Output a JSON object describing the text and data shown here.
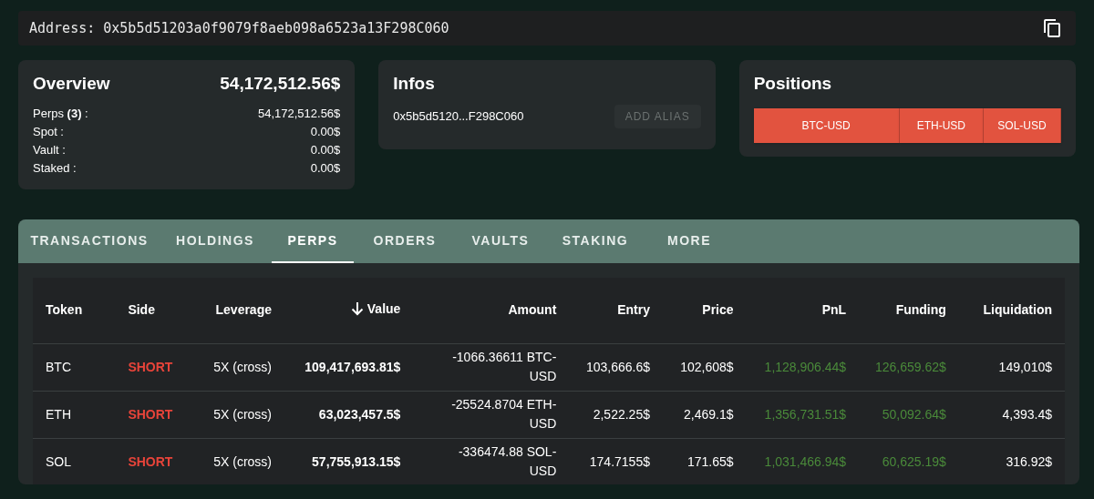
{
  "address_bar": {
    "label": "Address:",
    "address": "0x5b5d51203a0f9079f8aeb098a6523a13F298C060"
  },
  "overview": {
    "title": "Overview",
    "total": "54,172,512.56$",
    "rows": [
      {
        "label": "Perps **(3)** :",
        "value": "54,172,512.56$"
      },
      {
        "label": "Spot :",
        "value": "0.00$"
      },
      {
        "label": "Vault :",
        "value": "0.00$"
      },
      {
        "label": "Staked :",
        "value": "0.00$"
      }
    ]
  },
  "infos": {
    "title": "Infos",
    "address": "0x5b5d5120...F298C060",
    "button": "ADD ALIAS",
    "button_disabled": true
  },
  "positions": {
    "title": "Positions",
    "items": [
      "BTC-USD",
      "ETH-USD",
      "SOL-USD"
    ]
  },
  "tabs": [
    {
      "label": "TRANSACTIONS",
      "selected": false
    },
    {
      "label": "HOLDINGS",
      "selected": false
    },
    {
      "label": "PERPS",
      "selected": true
    },
    {
      "label": "ORDERS",
      "selected": false
    },
    {
      "label": "VAULTS",
      "selected": false
    },
    {
      "label": "STAKING",
      "selected": false
    },
    {
      "label": "MORE",
      "selected": false
    }
  ],
  "table": {
    "columns": [
      {
        "label": "Token",
        "sorted": false
      },
      {
        "label": "Side",
        "sorted": false
      },
      {
        "label": "Leverage",
        "sorted": false
      },
      {
        "label": "Value",
        "sorted": true
      },
      {
        "label": "Amount",
        "sorted": false
      },
      {
        "label": "Entry",
        "sorted": false
      },
      {
        "label": "Price",
        "sorted": false
      },
      {
        "label": "PnL",
        "sorted": false
      },
      {
        "label": "Funding",
        "sorted": false
      },
      {
        "label": "Liquidation",
        "sorted": false
      }
    ],
    "rows": [
      {
        "token": "BTC",
        "side": {
          "text": "SHORT",
          "kind": "short"
        },
        "leverage": "5X (cross)",
        "value": "109,417,693.81$",
        "amount": "-1066.36611 BTC-USD",
        "entry": "103,666.6$",
        "price": "102,608$",
        "pnl": {
          "text": "1,128,906.44$",
          "kind": "gain"
        },
        "funding": {
          "text": "126,659.62$",
          "kind": "gain"
        },
        "liquidation": "149,010$"
      },
      {
        "token": "ETH",
        "side": {
          "text": "SHORT",
          "kind": "short"
        },
        "leverage": "5X (cross)",
        "value": "63,023,457.5$",
        "amount": "-25524.8704 ETH-USD",
        "entry": "2,522.25$",
        "price": "2,469.1$",
        "pnl": {
          "text": "1,356,731.51$",
          "kind": "gain"
        },
        "funding": {
          "text": "50,092.64$",
          "kind": "gain"
        },
        "liquidation": "4,393.4$"
      },
      {
        "token": "SOL",
        "side": {
          "text": "SHORT",
          "kind": "short"
        },
        "leverage": "5X (cross)",
        "value": "57,755,913.15$",
        "amount": "-336474.88 SOL-USD",
        "entry": "174.7155$",
        "price": "171.65$",
        "pnl": {
          "text": "1,031,466.94$",
          "kind": "gain"
        },
        "funding": {
          "text": "60,625.19$",
          "kind": "gain"
        },
        "liquidation": "316.92$"
      }
    ]
  }
}
